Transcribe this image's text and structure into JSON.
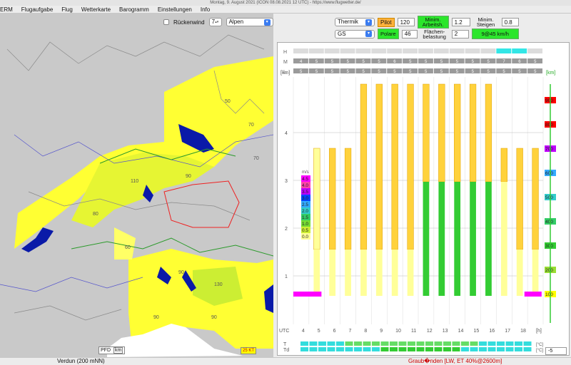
{
  "titlebar": {
    "text": "Montag, 9. August 2021 (ICON 08.08.2021 12 UTC) - https://www.flugwetter.de/"
  },
  "menu": [
    "ERM",
    "Flugaufgabe",
    "Flug",
    "Wetterkarte",
    "Barogramm",
    "Einstellungen",
    "Info"
  ],
  "map": {
    "rueckenwind_label": "Rückenwind",
    "rueckenwind_value": "7",
    "region": "Alpen",
    "pfd_label": "PFD",
    "km_label": "km",
    "scale_label": "25 KT",
    "labels": [
      "50",
      "70",
      "70",
      "90",
      "110",
      "80",
      "60",
      "90",
      "130",
      "90",
      "90"
    ]
  },
  "controls": {
    "mode": "Thermik",
    "pilot_label": "Pilot",
    "pilot_value": "120",
    "min_arbeits_label": "Minim. Arbeitsh.",
    "min_arbeits_value": "1.2",
    "min_steigen_label": "Minim. Steigen",
    "min_steigen_value": "0.8",
    "glider": "GS",
    "polare_label": "Polare",
    "polare_value": "46",
    "flaechen_label": "Flächen-belastung",
    "flaechen_value": "2",
    "result": "9@45 km/h"
  },
  "chart_data": {
    "type": "table",
    "row_labels": [
      "H",
      "M",
      "L"
    ],
    "left_axis_title": "[km]",
    "right_axis_title": "[km]",
    "left_axis": [
      "1",
      "2",
      "3",
      "4"
    ],
    "right_axis": [
      "900",
      "800",
      "700",
      "600",
      "500",
      "400",
      "300",
      "200",
      "100"
    ],
    "right_axis_colors": [
      "#ff0000",
      "#ff0000",
      "#c000ff",
      "#33aaff",
      "#33cccc",
      "#33cc66",
      "#33cc33",
      "#99dd33",
      "#ffff00"
    ],
    "utc_labels": [
      "UTC",
      "4",
      "5",
      "6",
      "7",
      "8",
      "9",
      "10",
      "11",
      "12",
      "13",
      "14",
      "15",
      "16",
      "17",
      "18",
      "[h]"
    ],
    "legend_title": "m/s",
    "legend_values": [
      "4.5",
      "4.0",
      "3.5",
      "3.0",
      "2.5",
      "2.0",
      "1.5",
      "1.0",
      "0.5",
      "0.0"
    ],
    "legend_colors": [
      "#ff00ff",
      "#ff44aa",
      "#c000ff",
      "#0044ff",
      "#33aaff",
      "#33cccc",
      "#33cc66",
      "#77dd33",
      "#ccee33",
      "#ffff99"
    ],
    "m_row": [
      "4",
      "5",
      "5",
      "5",
      "5",
      "5",
      "6",
      "5",
      "5",
      "5",
      "5",
      "5",
      "5",
      "7",
      "6",
      "5"
    ],
    "l_row": [
      "5",
      "5",
      "5",
      "5",
      "5",
      "5",
      "5",
      "5",
      "5",
      "5",
      "5",
      "5",
      "5",
      "5",
      "5",
      "5"
    ],
    "row_T": "T",
    "row_Td": "Td",
    "unit_c": "[°C]",
    "neg_value": "-5"
  },
  "status": {
    "left": "Verdun (200 mNN)",
    "right": "Graub�nden [LW, ET  40%@2600m]"
  }
}
